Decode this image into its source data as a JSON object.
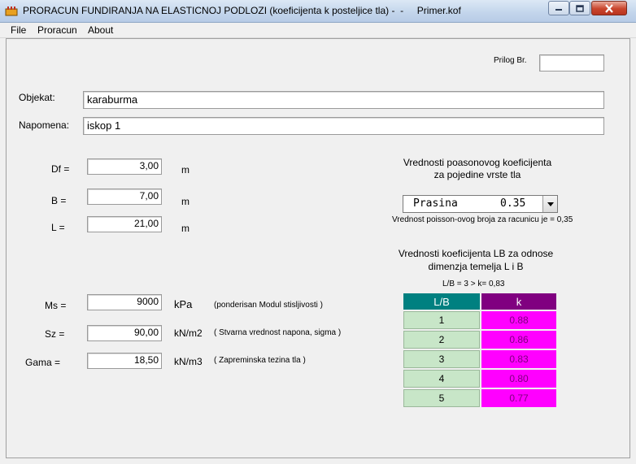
{
  "window": {
    "title": "PRORACUN FUNDIRANJA NA ELASTICNOJ PODLOZI (koeficijenta k posteljice tla) -  -     Primer.kof"
  },
  "menu": [
    "File",
    "Proracun",
    "About"
  ],
  "prilog": {
    "label": "Prilog Br.",
    "value": ""
  },
  "objekat": {
    "label": "Objekat:",
    "value": "karaburma"
  },
  "napomena": {
    "label": "Napomena:",
    "value": "iskop 1"
  },
  "dimensions": [
    {
      "label": "Df =",
      "value": "3,00",
      "unit": "m"
    },
    {
      "label": "B =",
      "value": "7,00",
      "unit": "m"
    },
    {
      "label": "L =",
      "value": "21,00",
      "unit": "m"
    }
  ],
  "params": [
    {
      "label": "Ms =",
      "value": "9000",
      "unit": "kPa",
      "note": "(ponderisan  Modul stisljivosti )"
    },
    {
      "label": "Sz =",
      "value": "90,00",
      "unit": "kN/m2",
      "note": "( Stvarna vrednost napona, sigma )"
    },
    {
      "label": "Gama =",
      "value": "18,50",
      "unit": "kN/m3",
      "note": "( Zapreminska tezina tla )"
    }
  ],
  "poisson": {
    "heading_line1": "Vrednosti poasonovog koeficijenta",
    "heading_line2": "za pojedine vrste tla",
    "selected_soil": "Prasina",
    "selected_value": "0.35",
    "note": "Vrednost poisson-ovog broja za racunicu je = 0,35"
  },
  "lb": {
    "heading_line1": "Vrednosti koeficijenta LB za odnose",
    "heading_line2": "dimenzja temelja  L i B",
    "result": "L/B = 3  >  k= 0,83",
    "col_lb": "L/B",
    "col_k": "k",
    "rows": [
      {
        "lb": "1",
        "k": "0.88"
      },
      {
        "lb": "2",
        "k": "0.86"
      },
      {
        "lb": "3",
        "k": "0.83"
      },
      {
        "lb": "4",
        "k": "0.80"
      },
      {
        "lb": "5",
        "k": "0.77"
      }
    ]
  },
  "colors": {
    "header_lb": "#008080",
    "header_k": "#800080",
    "cell_lb": "#c8e6c8",
    "cell_k": "#ff00ff"
  },
  "icons": {
    "app": "app-icon",
    "minimize": "minimize-icon",
    "maximize": "maximize-icon",
    "close": "close-icon",
    "dropdown": "chevron-down-icon"
  }
}
